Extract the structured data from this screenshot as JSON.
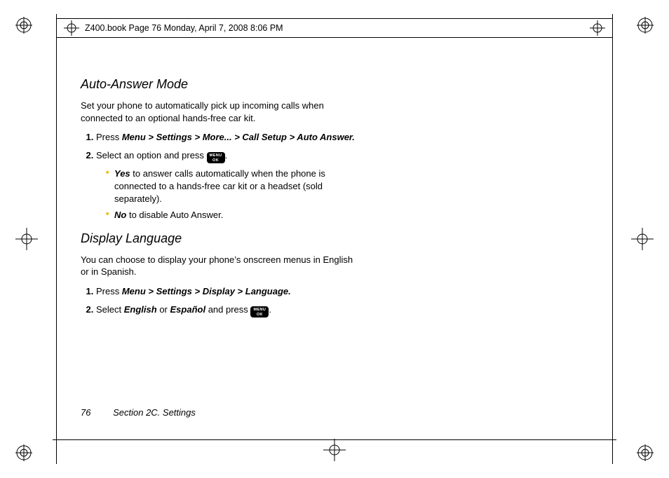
{
  "header": {
    "text": "Z400.book  Page 76  Monday, April 7, 2008  8:06 PM"
  },
  "sections": {
    "auto": {
      "title": "Auto-Answer Mode",
      "intro": "Set your phone to automatically pick up incoming calls when connected to an optional hands-free car kit.",
      "step1_press": "Press ",
      "step1_path": "Menu > Settings > More... > Call Setup > Auto Answer.",
      "step2_a": "Select an option and press ",
      "step2_b": ".",
      "yes_label": "Yes",
      "yes_text": " to answer calls automatically when the phone is connected to a hands-free car kit or a headset (sold separately).",
      "no_label": "No",
      "no_text": " to disable Auto Answer."
    },
    "lang": {
      "title": "Display Language",
      "intro": "You can choose to display your phone’s onscreen menus in English or in Spanish.",
      "step1_press": "Press ",
      "step1_path": "Menu > Settings > Display > Language.",
      "step2_a": "Select ",
      "step2_eng": "English",
      "step2_or": " or ",
      "step2_esp": "Español",
      "step2_b": " and press ",
      "step2_c": "."
    }
  },
  "menuok": {
    "line1": "MENU",
    "line2": "OK"
  },
  "footer": {
    "page": "76",
    "section": "Section 2C. Settings"
  }
}
